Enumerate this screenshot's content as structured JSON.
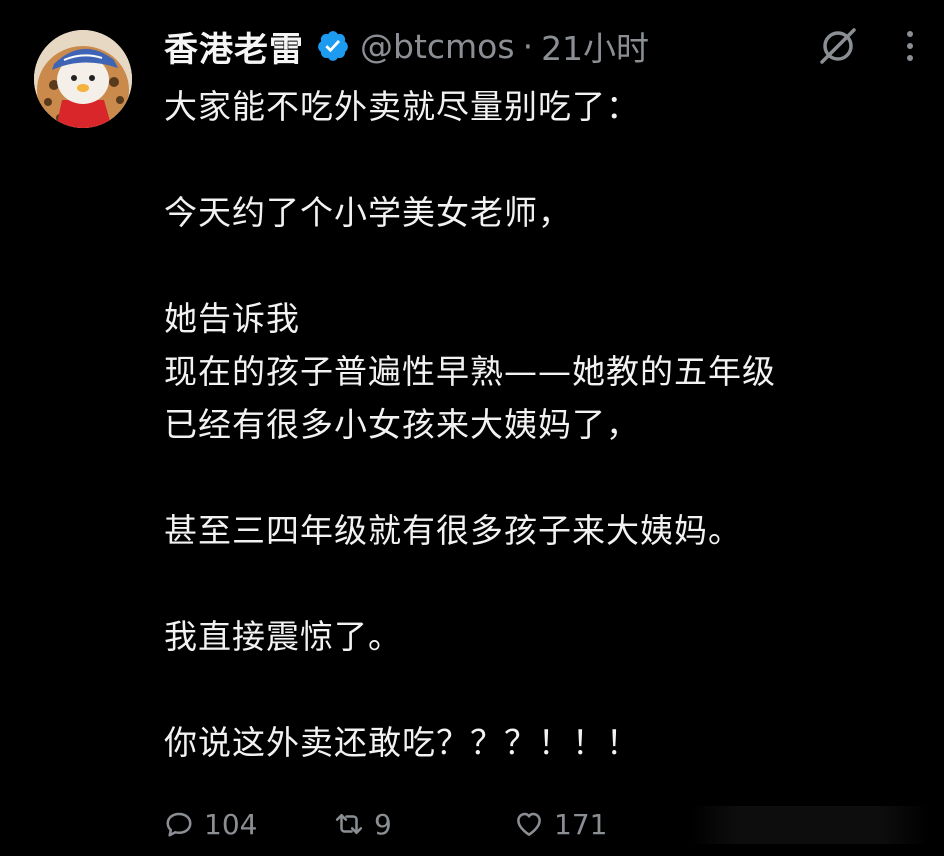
{
  "author": {
    "display_name": "香港老雷",
    "handle": "@btcmos",
    "separator": "·",
    "timestamp": "21小时",
    "avatar_icon": "cartoon-penguin-avatar",
    "verified_icon": "verified-badge-icon",
    "verified_color": "#1d9bf0"
  },
  "top_icons": {
    "grok_icon": "grok-icon",
    "more_icon": "more-vertical-icon"
  },
  "post": {
    "lines": [
      "大家能不吃外卖就尽量别吃了：",
      "",
      "今天约了个小学美女老师，",
      "",
      "她告诉我",
      "现在的孩子普遍性早熟——她教的五年级",
      "已经有很多小女孩来大姨妈了，",
      "",
      "甚至三四年级就有很多孩子来大姨妈。",
      "",
      "我直接震惊了。",
      "",
      "你说这外卖还敢吃？？？！！！"
    ]
  },
  "actions": {
    "reply": {
      "icon": "reply-icon",
      "count": "104"
    },
    "retweet": {
      "icon": "retweet-icon",
      "count": "9"
    },
    "like": {
      "icon": "heart-icon",
      "count": "171"
    }
  },
  "colors": {
    "background": "#000000",
    "text": "#f2f2f2",
    "muted": "#8b8f94"
  }
}
